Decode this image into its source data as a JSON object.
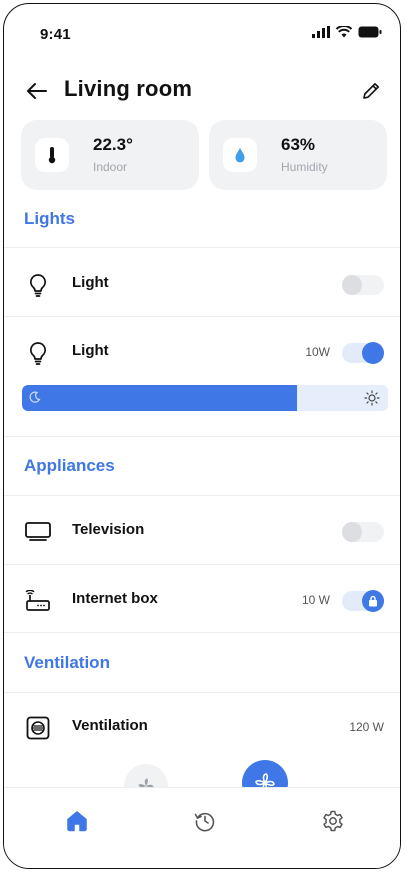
{
  "status": {
    "time": "9:41"
  },
  "header": {
    "title": "Living room"
  },
  "cards": [
    {
      "value": "22.3°",
      "label": "Indoor",
      "icon": "thermometer-icon"
    },
    {
      "value": "63%",
      "label": "Humidity",
      "icon": "water-drop-icon"
    }
  ],
  "sections": {
    "lights": "Lights",
    "appliances": "Appliances",
    "ventilation": "Ventilation"
  },
  "lights": [
    {
      "label": "Light",
      "power": "",
      "on": false
    },
    {
      "label": "Light",
      "power": "10W",
      "on": true,
      "brightness": 0.75
    }
  ],
  "appliances": [
    {
      "label": "Television",
      "power": "",
      "on": false
    },
    {
      "label": "Internet box",
      "power": "10 W",
      "on": true,
      "locked": true
    }
  ],
  "ventilation": [
    {
      "label": "Ventilation",
      "power": "120 W"
    }
  ],
  "colors": {
    "accent": "#3f77e6",
    "card_bg": "#f1f2f4",
    "muted": "#a2a6ad"
  }
}
